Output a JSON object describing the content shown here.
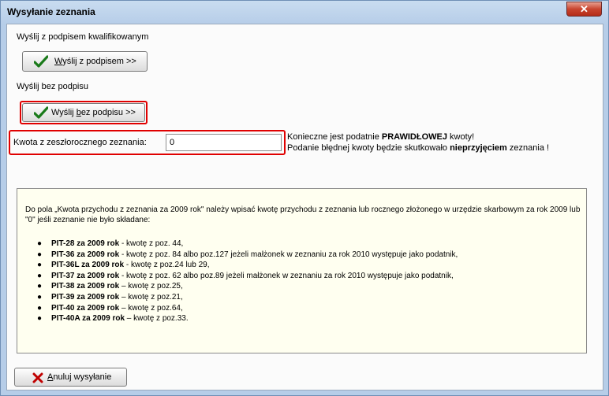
{
  "window": {
    "title": "Wysyłanie zeznania",
    "close_glyph": "✕"
  },
  "signed": {
    "section_label": "Wyślij z podpisem kwalifikowanym",
    "button_mnemonic": "W",
    "button_rest": "yślij z podpisem >>",
    "icon": "check-icon"
  },
  "unsigned": {
    "section_label": "Wyślij bez podpisu",
    "button_pre": "Wyślij ",
    "button_mnemonic": "b",
    "button_rest": "ez podpisu >>",
    "icon": "check-icon"
  },
  "amount": {
    "label": "Kwota z zeszłorocznego zeznania:",
    "value": "0",
    "warning_line1_pre": "Konieczne jest podatnie ",
    "warning_line1_bold": "PRAWIDŁOWEJ",
    "warning_line1_post": " kwoty!",
    "warning_line2_pre": "Podanie błędnej kwoty będzie skutkowało ",
    "warning_line2_bold": "nieprzyjęciem",
    "warning_line2_post": " zeznania !"
  },
  "info": {
    "intro": "Do pola „Kwota przychodu z zeznania za 2009 rok\" należy wpisać kwotę przychodu z zeznania lub rocznego złożonego w urzędzie skarbowym za rok 2009 lub \"0\" jeśli zeznanie nie było składane:",
    "items": [
      {
        "bold": "PIT-28 za 2009 rok",
        "text": " - kwotę z poz. 44,"
      },
      {
        "bold": "PIT-36 za 2009 rok",
        "text": " - kwotę z poz. 84 albo poz.127 jeżeli małżonek w zeznaniu za rok 2010 występuje jako podatnik,"
      },
      {
        "bold": "PIT-36L za 2009 rok",
        "text": " - kwotę z poz.24 lub 29,"
      },
      {
        "bold": "PIT-37 za 2009 rok",
        "text": " - kwotę z poz. 62 albo poz.89 jeżeli małżonek w zeznaniu za rok 2010 występuje jako podatnik,"
      },
      {
        "bold": "PIT-38 za 2009 rok",
        "text": " – kwotę z poz.25,"
      },
      {
        "bold": "PIT-39 za 2009 rok",
        "text": " – kwotę z poz.21,"
      },
      {
        "bold": "PIT-40 za 2009 rok",
        "text": " – kwotę z poz.64,"
      },
      {
        "bold": "PIT-40A za 2009 rok",
        "text": " – kwotę z poz.33."
      }
    ]
  },
  "cancel": {
    "mnemonic": "A",
    "rest": "nuluj wysyłanie",
    "icon": "x-icon"
  },
  "colors": {
    "highlight": "#e00000",
    "check": "#1a7a1a",
    "cancel_x": "#c00000"
  }
}
